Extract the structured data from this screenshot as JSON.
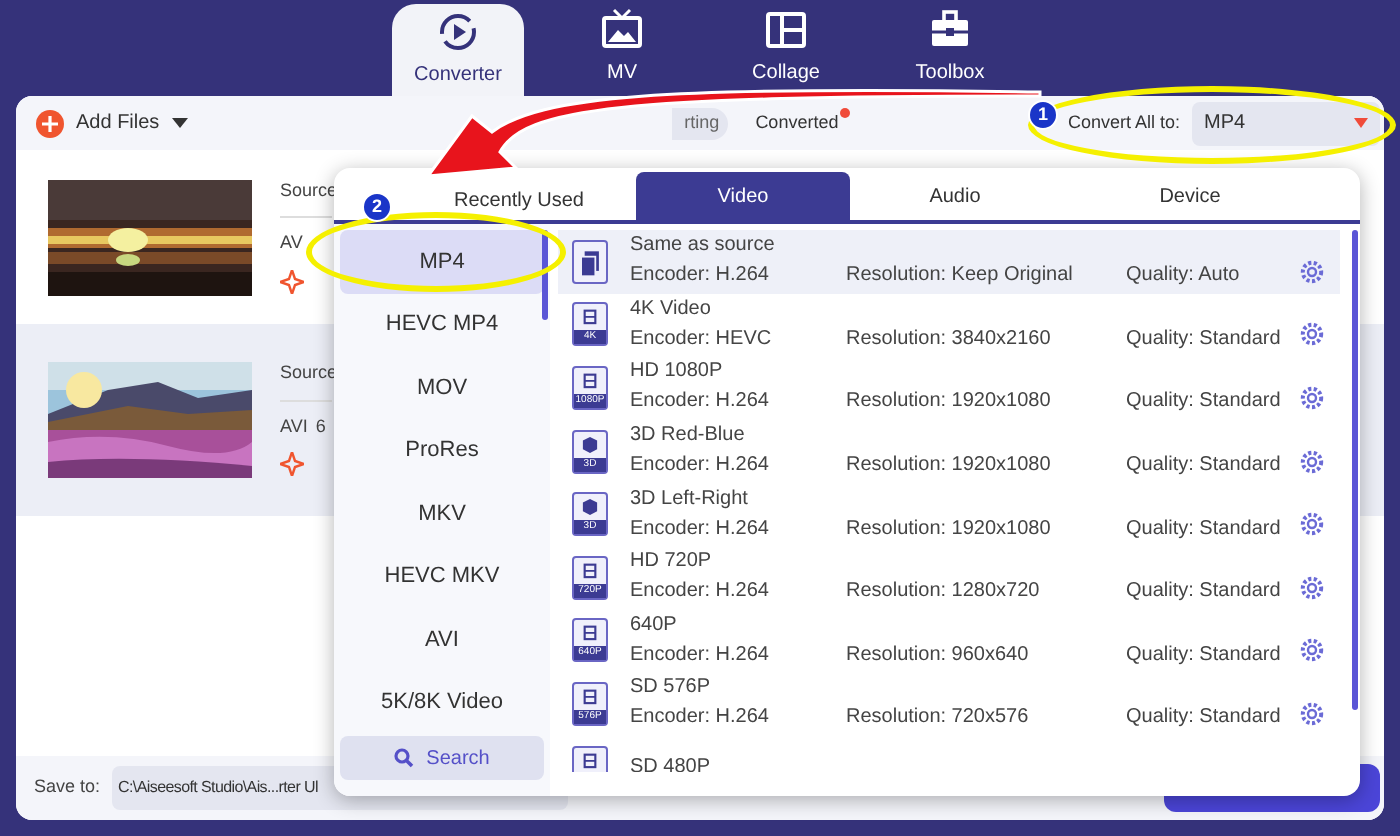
{
  "nav_tabs": [
    {
      "label": "Converter",
      "kind": "converter",
      "selected": true
    },
    {
      "label": "MV",
      "kind": "mv",
      "selected": false
    },
    {
      "label": "Collage",
      "kind": "collage",
      "selected": false
    },
    {
      "label": "Toolbox",
      "kind": "toolbox",
      "selected": false
    }
  ],
  "toolbar": {
    "add_files": "Add Files",
    "tabs": [
      {
        "label": "rting",
        "selected": true
      },
      {
        "label": "Converted",
        "selected": false,
        "badge": true
      }
    ],
    "convert_all_label": "Convert All to:",
    "convert_all_value": "MP4"
  },
  "files": [
    {
      "kind": "sunset",
      "source": "Source",
      "format": "AV",
      "selected": false
    },
    {
      "kind": "meadow",
      "source": "Source",
      "format": "AVI",
      "size": "6",
      "selected": true
    }
  ],
  "save_to": {
    "label": "Save to:",
    "value": "C:\\Aiseesoft Studio\\Ais...rter Ul"
  },
  "format_panel": {
    "tabs": [
      {
        "label": "Recently Used",
        "selected": false
      },
      {
        "label": "Video",
        "selected": true
      },
      {
        "label": "Audio",
        "selected": false
      },
      {
        "label": "Device",
        "selected": false
      }
    ],
    "categories": [
      {
        "label": "MP4",
        "selected": true
      },
      {
        "label": "HEVC MP4",
        "selected": false
      },
      {
        "label": "MOV",
        "selected": false
      },
      {
        "label": "ProRes",
        "selected": false
      },
      {
        "label": "MKV",
        "selected": false
      },
      {
        "label": "HEVC MKV",
        "selected": false
      },
      {
        "label": "AVI",
        "selected": false
      },
      {
        "label": "5K/8K Video",
        "selected": false
      }
    ],
    "search": "Search",
    "presets": [
      {
        "name": "Same as source",
        "kind": "source",
        "encoder": "Encoder: H.264",
        "resolution": "Resolution: Keep Original",
        "quality": "Quality: Auto",
        "selected": true
      },
      {
        "name": "4K Video",
        "kind": "film",
        "badge": "4K",
        "encoder": "Encoder: HEVC",
        "resolution": "Resolution: 3840x2160",
        "quality": "Quality: Standard",
        "selected": false
      },
      {
        "name": "HD 1080P",
        "kind": "film",
        "badge": "1080P",
        "encoder": "Encoder: H.264",
        "resolution": "Resolution: 1920x1080",
        "quality": "Quality: Standard",
        "selected": false
      },
      {
        "name": "3D Red-Blue",
        "kind": "cube",
        "badge": "3D",
        "encoder": "Encoder: H.264",
        "resolution": "Resolution: 1920x1080",
        "quality": "Quality: Standard",
        "selected": false
      },
      {
        "name": "3D Left-Right",
        "kind": "cube",
        "badge": "3D",
        "encoder": "Encoder: H.264",
        "resolution": "Resolution: 1920x1080",
        "quality": "Quality: Standard",
        "selected": false
      },
      {
        "name": "HD 720P",
        "kind": "film",
        "badge": "720P",
        "encoder": "Encoder: H.264",
        "resolution": "Resolution: 1280x720",
        "quality": "Quality: Standard",
        "selected": false
      },
      {
        "name": "640P",
        "kind": "film",
        "badge": "640P",
        "encoder": "Encoder: H.264",
        "resolution": "Resolution: 960x640",
        "quality": "Quality: Standard",
        "selected": false
      },
      {
        "name": "SD 576P",
        "kind": "film",
        "badge": "576P",
        "encoder": "Encoder: H.264",
        "resolution": "Resolution: 720x576",
        "quality": "Quality: Standard",
        "selected": false
      },
      {
        "name": "SD 480P",
        "kind": "film",
        "selected": false
      }
    ]
  },
  "annotations": [
    {
      "number": "1"
    },
    {
      "number": "2"
    }
  ]
}
